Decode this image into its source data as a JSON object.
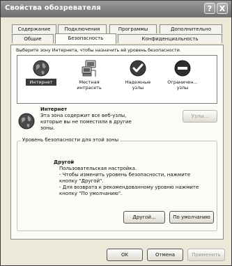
{
  "window": {
    "title": "Свойства обозревателя",
    "help_button": "?",
    "close_button": "X"
  },
  "tabs": {
    "row_top": [
      "Содержание",
      "Подключения",
      "Программы",
      "Дополнительно"
    ],
    "row_bottom": [
      "Общие",
      "Безопасность",
      "Конфиденциальность"
    ],
    "active": "Безопасность"
  },
  "security": {
    "prompt": "Выберите зону Интернета, чтобы назначить ей уровень безопасности.",
    "zones": [
      {
        "label": "Интернет",
        "icon": "globe-icon",
        "selected": true
      },
      {
        "label": "Местная интрасеть",
        "icon": "intranet-computer-icon",
        "selected": false
      },
      {
        "label": "Надежные узлы",
        "icon": "checkmark-icon",
        "selected": false
      },
      {
        "label": "Ограничен... узлы",
        "icon": "restricted-icon",
        "selected": false
      }
    ],
    "zone_title": "Интернет",
    "zone_desc": [
      "Эта зона содержит все веб-узлы,",
      "которые вы не поместили в другие",
      "зоны."
    ],
    "sites_button": "Узлы...",
    "level_group_title": "Уровень безопасности для этой зоны",
    "level_title": "Другой",
    "level_desc": [
      "Пользовательская настройка.",
      "- Чтобы изменить уровень безопасности, нажмите",
      "кнопку \"Другой\".",
      "- Для возврата к рекомендованному уровню нажмите",
      "кнопку \"По умолчанию\"."
    ],
    "custom_button": "Другой...",
    "default_button": "По умолчанию"
  },
  "footer": {
    "ok": "OK",
    "cancel": "Отмена",
    "apply": "Применить"
  },
  "colors": {
    "accent_selection": "#3a3a3a",
    "dialog_bg": "#ece9d8"
  }
}
